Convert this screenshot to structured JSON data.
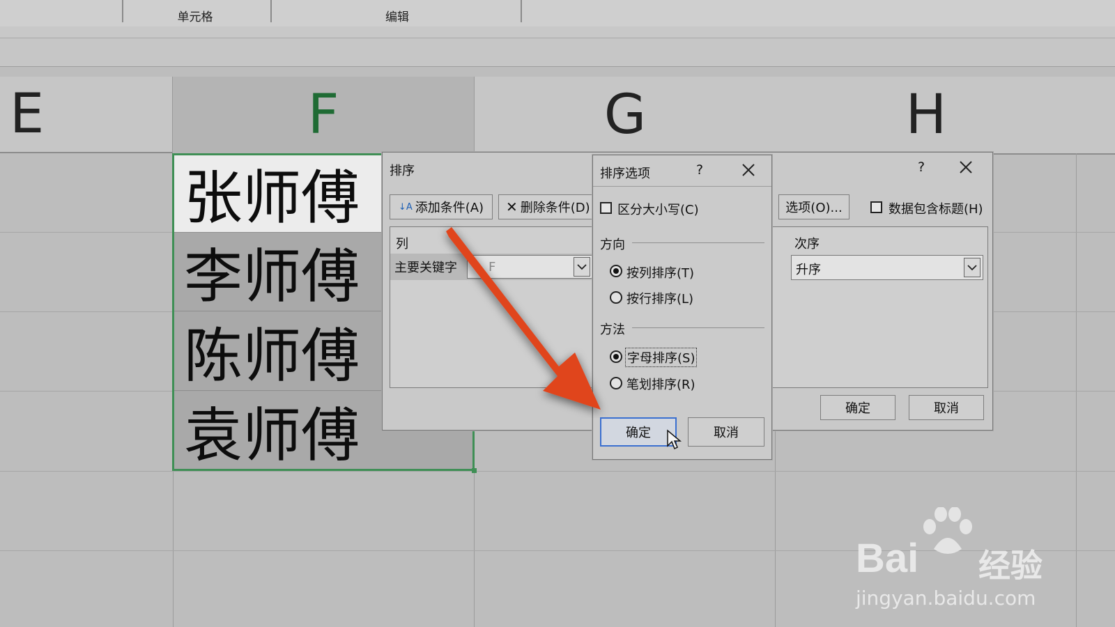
{
  "ribbon": {
    "groups": [
      "单元格",
      "编辑"
    ]
  },
  "columns": [
    "E",
    "F",
    "G",
    "H"
  ],
  "cells": [
    "张师傅",
    "李师傅",
    "陈师傅",
    "袁师傅"
  ],
  "sort_dialog": {
    "title": "排序",
    "add_condition": "添加条件(A)",
    "delete_condition": "删除条件(D)",
    "options_button": "选项(O)...",
    "has_header_label": "数据包含标题(H)",
    "help_symbol": "?",
    "column_header": "列",
    "order_header": "次序",
    "primary_key_label": "主要关键字",
    "primary_key_value": "F",
    "order_value": "升序",
    "ok": "确定",
    "cancel": "取消"
  },
  "options_dialog": {
    "title": "排序选项",
    "help_symbol": "?",
    "case_sensitive": "区分大小写(C)",
    "direction_label": "方向",
    "by_column": "按列排序(T)",
    "by_row": "按行排序(L)",
    "method_label": "方法",
    "alphabetic": "字母排序(S)",
    "stroke": "笔划排序(R)",
    "ok": "确定",
    "cancel": "取消"
  },
  "watermark": {
    "brand": "Bai",
    "brand_suffix": "经验",
    "url": "jingyan.baidu.com"
  },
  "colors": {
    "selection": "#3f8f55",
    "arrow": "#e0451f",
    "primary_button_border": "#3a6fd0"
  }
}
